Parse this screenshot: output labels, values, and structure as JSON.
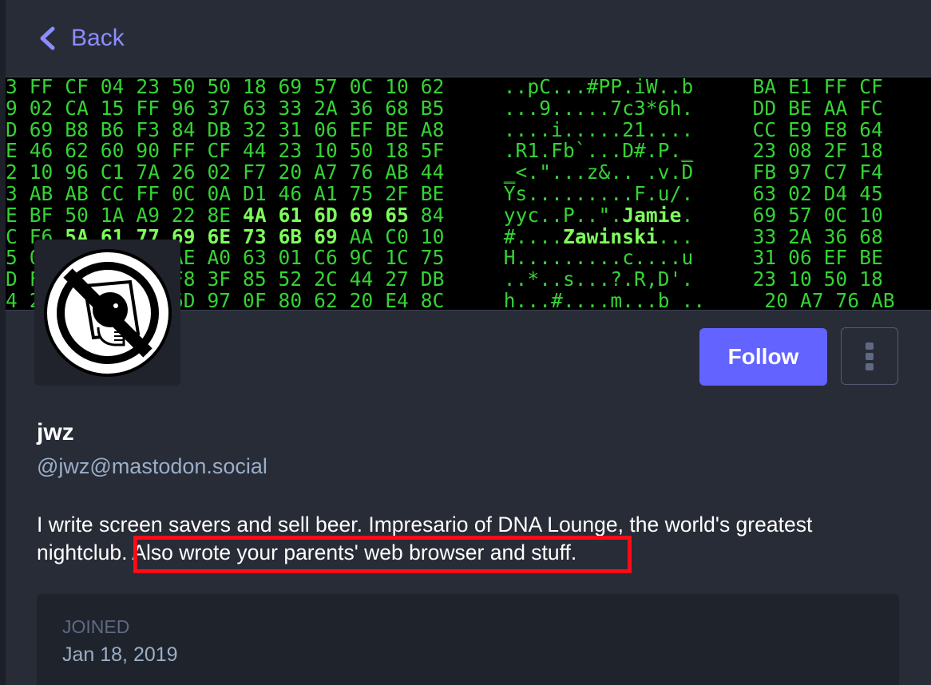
{
  "nav": {
    "back_label": "Back"
  },
  "banner": {
    "hex_lines": [
      [
        "3 FF CF 04 23 50 50 18 69 57 0C 10 62     ..pC...#PP.iW..b     BA E1 FF CF"
      ],
      [
        "9 02 CA 15 FF 96 37 63 33 2A 36 68 B5     ...9.....7c3*6h.     DD BE AA FC"
      ],
      [
        "D 69 B8 B6 F3 84 DB 32 31 06 EF BE A8     ....i.....21....     CC E9 E8 64"
      ],
      [
        "E 46 62 60 90 FF CF 44 23 10 50 18 5F     .R1.Fb`...D#.P._     23 08 2F 18"
      ],
      [
        "2 10 96 C1 7A 26 02 F7 20 A7 76 AB 44     _<.\"...z&.. .v.D̅     FB 97 C7 F4"
      ],
      [
        "3 AB AB CC FF 0C 0A D1 46 A1 75 2F BE     Y̅s.........F.u/.     63 02 D4 45"
      ],
      [
        "E BF 50 1A A9 22 8E ",
        "4A 61 6D 69 65",
        " 84     yyc..P..\".",
        "Jamie",
        ".     69 57 0C 10"
      ],
      [
        "C F6 ",
        "5A 61 77 69 6E 73 6B 69",
        " AA C0 10     #....",
        "Zawinski",
        "...     33 2A 36 68"
      ],
      [
        "5 0E 6A B7 95 AE A0 63 01 C6 9C 1C 75     H.........c....u     31 06 EF BE"
      ],
      [
        "D FA 2F 0B 73 F8 3F 85 52 2C 44 27 DB     ..*..s...?.R,D'.     23 10 50 18"
      ],
      [
        "4 23 C2 96 0A 6D 97 0F 80 62 20 E4 8C     h...#....m...b ..     20 A7 76 AB"
      ]
    ]
  },
  "profile": {
    "display_name": "jwz",
    "handle": "@jwz@mastodon.social",
    "follow_label": "Follow",
    "bio_part1": "I write screen savers and sell beer. Impresario of DNA Lounge, the world's greatest nightclub. ",
    "bio_part2": "Also wrote your parents' web browser and stuff.",
    "joined_label": "JOINED",
    "joined_value": "Jan 18, 2019"
  },
  "colors": {
    "background": "#282c37",
    "accent": "#6364ff",
    "link": "#8c8dff",
    "highlight_box": "#ff0a18",
    "banner_text": "#35d335"
  },
  "icons": {
    "back": "chevron-left-icon",
    "menu": "ellipsis-vertical-icon",
    "avatar": "no-screaming-face-avatar"
  }
}
